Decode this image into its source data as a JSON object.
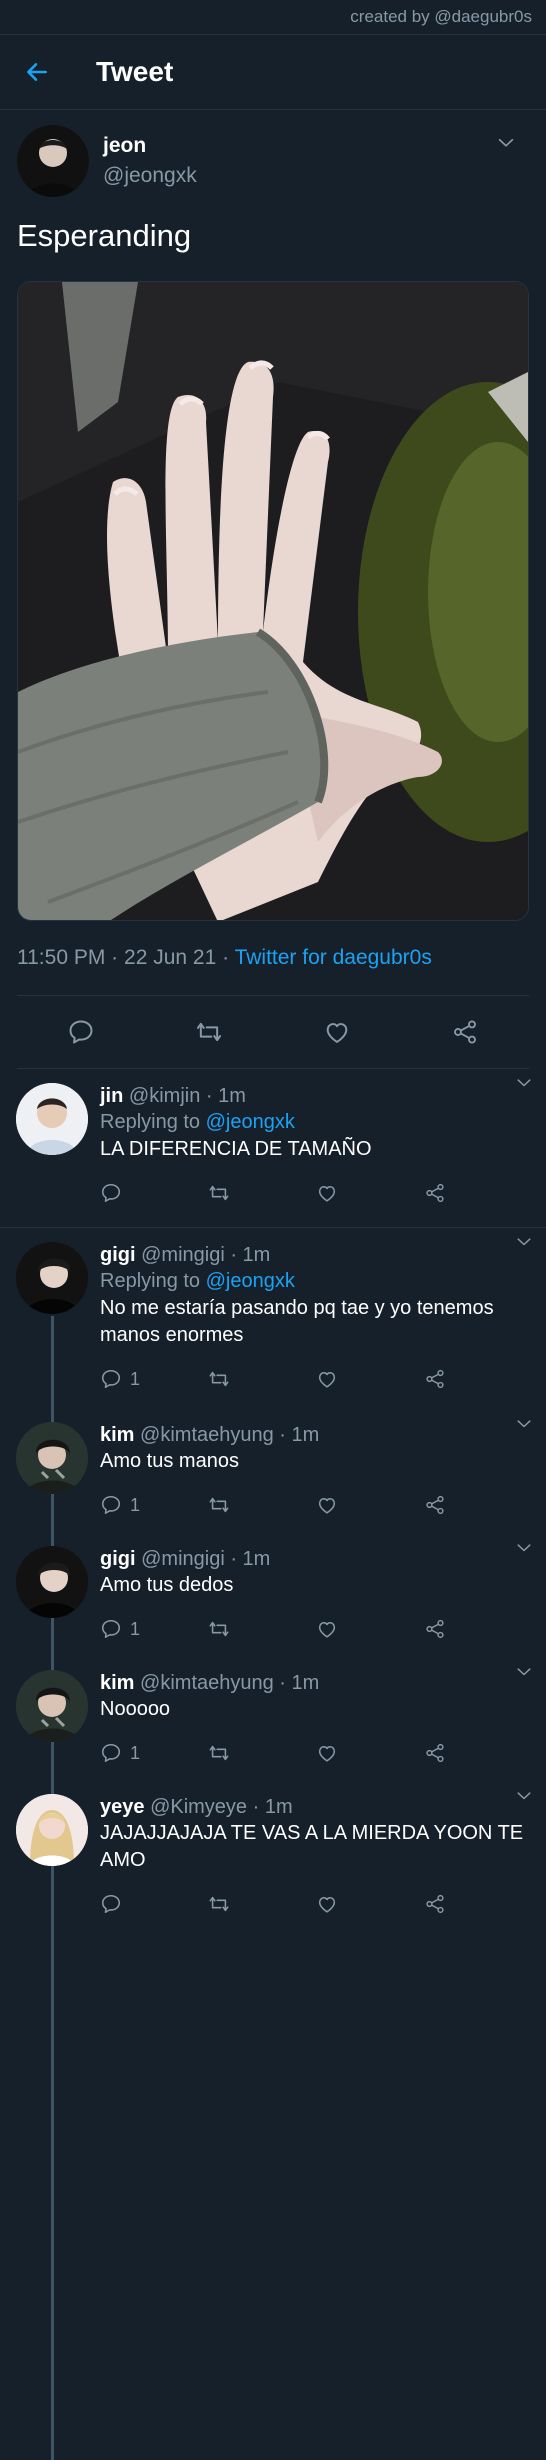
{
  "credit": "created by @daegubr0s",
  "header": {
    "title": "Tweet"
  },
  "tweet": {
    "display_name": "jeon",
    "handle": "@jeongxk",
    "text": "Esperanding",
    "time": "11:50 PM",
    "date": "22 Jun 21",
    "separator": "·",
    "source": "Twitter for daegubr0s"
  },
  "replies": [
    {
      "name": "jin",
      "handle": "@kimjin",
      "time": "· 1m",
      "replying_prefix": "Replying to ",
      "replying_to": "@jeongxk",
      "text": "LA DIFERENCIA DE TAMAÑO",
      "reply_count": ""
    },
    {
      "name": "gigi",
      "handle": "@mingigi",
      "time": "· 1m",
      "replying_prefix": "Replying to ",
      "replying_to": "@jeongxk",
      "text": "No me estaría pasando pq tae y yo tenemos manos enormes",
      "reply_count": "1"
    },
    {
      "name": "kim",
      "handle": "@kimtaehyung",
      "time": "· 1m",
      "text": "Amo tus manos",
      "reply_count": "1"
    },
    {
      "name": "gigi",
      "handle": "@mingigi",
      "time": "· 1m",
      "text": "Amo tus dedos",
      "reply_count": "1"
    },
    {
      "name": "kim",
      "handle": "@kimtaehyung",
      "time": "· 1m",
      "text": "Nooooo",
      "reply_count": "1"
    },
    {
      "name": "yeye",
      "handle": "@Kimyeye",
      "time": "· 1m",
      "text": "JAJAJJAJAJA TE VAS A LA MIERDA YOON TE AMO",
      "reply_count": ""
    }
  ],
  "colors": {
    "background": "#15202b",
    "accent": "#1da1f2",
    "muted": "#8899a6",
    "divider": "#26343f"
  },
  "icons": [
    "back-arrow-icon",
    "chevron-down-icon",
    "reply-icon",
    "retweet-icon",
    "like-icon",
    "share-icon"
  ]
}
